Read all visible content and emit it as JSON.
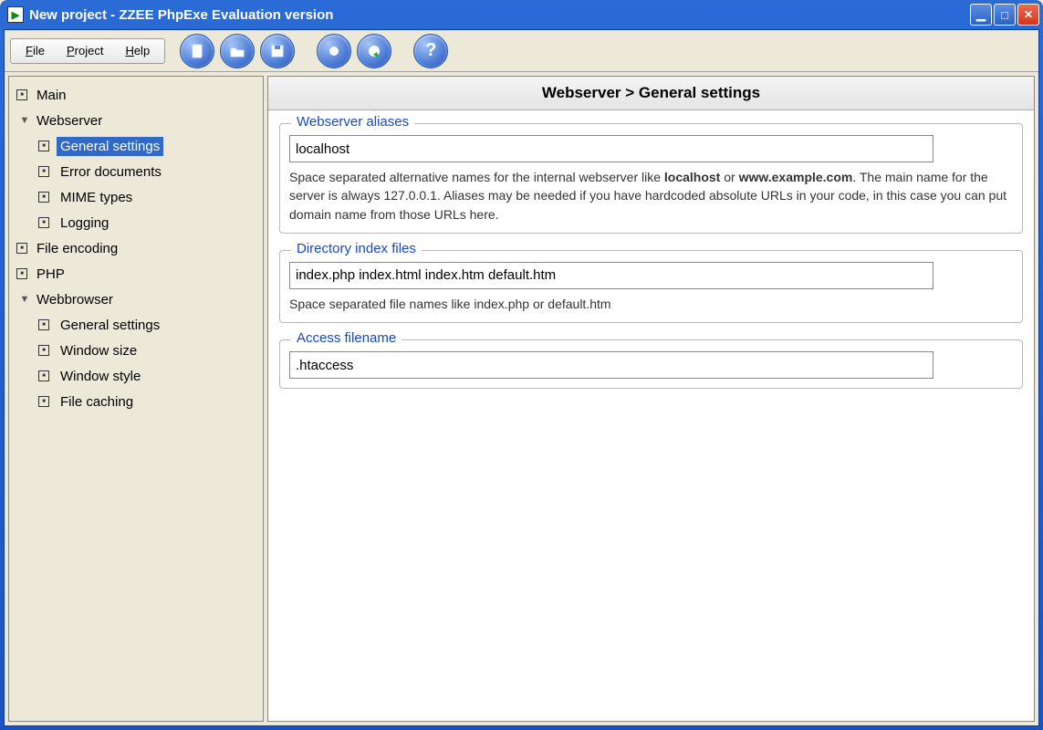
{
  "window": {
    "title": "New project - ZZEE PhpExe Evaluation version"
  },
  "menubar": {
    "file": "File",
    "project": "Project",
    "help": "Help"
  },
  "toolbar_icons": {
    "new": "new-file-icon",
    "open": "open-folder-icon",
    "save": "save-disk-icon",
    "run": "run-circle-icon",
    "run_arrow": "run-arrow-icon",
    "help": "help-icon"
  },
  "sidebar": {
    "items": [
      {
        "label": "Main",
        "kind": "leaf",
        "indent": 0
      },
      {
        "label": "Webserver",
        "kind": "expanded",
        "indent": 0
      },
      {
        "label": "General settings",
        "kind": "leaf",
        "indent": 1,
        "selected": true
      },
      {
        "label": "Error documents",
        "kind": "leaf",
        "indent": 1
      },
      {
        "label": "MIME types",
        "kind": "leaf",
        "indent": 1
      },
      {
        "label": "Logging",
        "kind": "leaf",
        "indent": 1
      },
      {
        "label": "File encoding",
        "kind": "leaf",
        "indent": 0
      },
      {
        "label": "PHP",
        "kind": "leaf",
        "indent": 0
      },
      {
        "label": "Webbrowser",
        "kind": "expanded",
        "indent": 0
      },
      {
        "label": "General settings",
        "kind": "leaf",
        "indent": 1
      },
      {
        "label": "Window size",
        "kind": "leaf",
        "indent": 1
      },
      {
        "label": "Window style",
        "kind": "leaf",
        "indent": 1
      },
      {
        "label": "File caching",
        "kind": "leaf",
        "indent": 1
      }
    ]
  },
  "panel": {
    "breadcrumb": "Webserver > General settings",
    "groups": {
      "aliases": {
        "legend": "Webserver aliases",
        "value": "localhost",
        "help_pre": "Space separated alternative names for the internal webserver like ",
        "help_b1": "localhost",
        "help_mid": " or ",
        "help_b2": "www.example.com",
        "help_post": ". The main name for the server is always 127.0.0.1. Aliases may be needed if you have hardcoded absolute URLs in your code, in this case you can put domain name from those URLs here."
      },
      "index": {
        "legend": "Directory index files",
        "value": "index.php index.html index.htm default.htm",
        "help": "Space separated file names like index.php or default.htm"
      },
      "access": {
        "legend": "Access filename",
        "value": ".htaccess"
      }
    }
  }
}
